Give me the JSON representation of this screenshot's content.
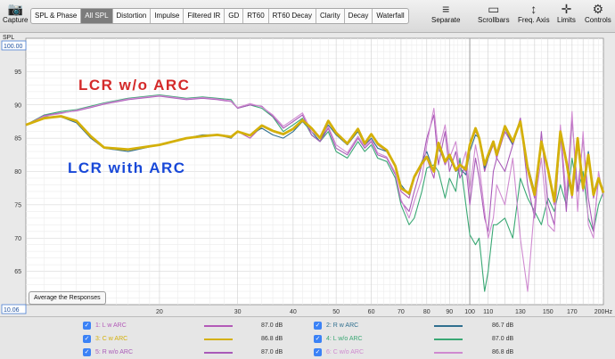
{
  "toolbar": {
    "capture": "Capture",
    "tabs": [
      "SPL & Phase",
      "All SPL",
      "Distortion",
      "Impulse",
      "Filtered IR",
      "GD",
      "RT60",
      "RT60 Decay",
      "Clarity",
      "Decay",
      "Waterfall"
    ],
    "active_tab": "All SPL",
    "tools": [
      "Separate",
      "Scrollbars",
      "Freq. Axis",
      "Limits",
      "Controls"
    ]
  },
  "plot": {
    "y_unit": "SPL",
    "y_top_box": "100.00",
    "y_bottom_box": "10.06",
    "annotation_top": "LCR w/o ARC",
    "annotation_bottom": "LCR with ARC",
    "annotation_top_color": "#d42a2a",
    "annotation_bottom_color": "#1848d8",
    "average_button": "Average the Responses"
  },
  "chart_data": {
    "type": "line",
    "xscale": "log",
    "xlim": [
      10,
      200
    ],
    "ylim": [
      60,
      100
    ],
    "y_ticks": [
      60,
      65,
      70,
      75,
      80,
      85,
      90,
      95
    ],
    "x_ticks": [
      {
        "v": 20,
        "label": "20"
      },
      {
        "v": 30,
        "label": "30"
      },
      {
        "v": 40,
        "label": "40"
      },
      {
        "v": 50,
        "label": "50"
      },
      {
        "v": 60,
        "label": "60"
      },
      {
        "v": 70,
        "label": "70"
      },
      {
        "v": 80,
        "label": "80"
      },
      {
        "v": 90,
        "label": "90"
      },
      {
        "v": 100,
        "label": "100"
      },
      {
        "v": 110,
        "label": "110"
      },
      {
        "v": 130,
        "label": "130"
      },
      {
        "v": 150,
        "label": "150"
      },
      {
        "v": 170,
        "label": "170"
      },
      {
        "v": 200,
        "label": "200Hz"
      }
    ],
    "marker_x": 100,
    "series": [
      {
        "name": "1: L w ARC",
        "color": "#b35ab8",
        "value": "87.0 dB",
        "width": 1.1,
        "x": [
          10,
          11,
          12,
          13,
          14,
          15,
          17,
          20,
          23,
          25,
          27,
          29,
          30,
          32,
          34,
          36,
          38,
          40,
          42,
          44,
          46,
          48,
          50,
          53,
          56,
          58,
          60,
          62,
          65,
          68,
          70,
          73,
          75,
          78,
          80,
          83,
          85,
          88,
          90,
          93,
          95,
          98,
          100,
          103,
          105,
          108,
          110,
          113,
          115,
          120,
          125,
          130,
          135,
          140,
          145,
          150,
          155,
          160,
          165,
          170,
          175,
          180,
          185,
          190,
          195,
          200
        ],
        "y": [
          87,
          88,
          88.3,
          87.5,
          85,
          83.5,
          83.2,
          84,
          85,
          85.3,
          85.5,
          85,
          86,
          85,
          86.8,
          86,
          85.5,
          86.5,
          87.5,
          86.5,
          85,
          87.5,
          86,
          84,
          86.5,
          84,
          85.5,
          84,
          83,
          81,
          77,
          76,
          79,
          81,
          82,
          79,
          84,
          81,
          82.5,
          80,
          81,
          80,
          84,
          86,
          85,
          80,
          82,
          84,
          82,
          86,
          84,
          88,
          80,
          76,
          84,
          80,
          75,
          86,
          81,
          76,
          84,
          77,
          82,
          76,
          79,
          77
        ]
      },
      {
        "name": "2: R w ARC",
        "color": "#2f6f8f",
        "value": "86.7 dB",
        "width": 1.1,
        "x": [
          10,
          11,
          12,
          13,
          14,
          15,
          17,
          20,
          23,
          25,
          27,
          29,
          30,
          32,
          34,
          36,
          38,
          40,
          42,
          44,
          46,
          48,
          50,
          53,
          56,
          58,
          60,
          62,
          65,
          68,
          70,
          73,
          75,
          78,
          80,
          83,
          85,
          88,
          90,
          93,
          95,
          98,
          100,
          103,
          105,
          108,
          110,
          113,
          115,
          120,
          125,
          130,
          135,
          140,
          145,
          150,
          155,
          160,
          165,
          170,
          175,
          180,
          185,
          190,
          195,
          200
        ],
        "y": [
          87,
          88.2,
          88.2,
          87.3,
          85,
          83.5,
          83,
          84,
          85,
          85.5,
          85.5,
          85,
          86,
          85.5,
          86.5,
          85.5,
          85,
          86,
          87.5,
          86,
          84.5,
          87,
          85.5,
          84,
          86,
          84,
          85,
          83.5,
          83,
          81,
          78,
          76.5,
          79,
          81.5,
          83,
          80,
          83.5,
          81.5,
          82,
          80,
          80.5,
          79.5,
          83,
          85.5,
          85,
          80.5,
          82,
          84.5,
          82.5,
          86.5,
          84,
          87.5,
          81,
          77,
          84.5,
          80,
          76,
          86,
          82,
          77,
          85,
          78,
          83,
          77,
          79,
          77
        ]
      },
      {
        "name": "3: C w ARC",
        "color": "#d4b00a",
        "value": "86.8 dB",
        "width": 2.8,
        "x": [
          10,
          11,
          12,
          13,
          14,
          15,
          17,
          20,
          23,
          25,
          27,
          29,
          30,
          32,
          34,
          36,
          38,
          40,
          42,
          44,
          46,
          48,
          50,
          53,
          56,
          58,
          60,
          62,
          65,
          68,
          70,
          73,
          75,
          78,
          80,
          83,
          85,
          88,
          90,
          93,
          95,
          98,
          100,
          103,
          105,
          108,
          110,
          113,
          115,
          120,
          125,
          130,
          135,
          140,
          145,
          150,
          155,
          160,
          165,
          170,
          175,
          180,
          185,
          190,
          195,
          200
        ],
        "y": [
          87,
          88,
          88.3,
          87.6,
          85.3,
          83.6,
          83.3,
          84,
          85,
          85.3,
          85.5,
          85.2,
          86,
          85.4,
          86.9,
          86.1,
          85.6,
          86.4,
          87.7,
          86.5,
          85,
          87.6,
          85.8,
          84.2,
          86.4,
          84.2,
          85.6,
          84.2,
          83.2,
          80.8,
          77.5,
          76.7,
          79.2,
          81.2,
          82.2,
          80,
          84.3,
          81.5,
          82.5,
          80.2,
          81,
          80.3,
          84,
          86.5,
          85,
          81,
          82.5,
          84.5,
          82.5,
          86.8,
          84.5,
          87.5,
          80.5,
          76.5,
          84.5,
          80.3,
          75.5,
          86,
          81.5,
          76.5,
          85,
          77.5,
          82.5,
          76.5,
          79,
          76.8
        ]
      },
      {
        "name": "4: L w/o ARC",
        "color": "#3aa874",
        "value": "87.0 dB",
        "width": 1.1,
        "x": [
          10,
          11,
          12,
          13,
          14,
          15,
          17,
          20,
          23,
          25,
          27,
          29,
          30,
          32,
          34,
          36,
          38,
          40,
          42,
          44,
          46,
          48,
          50,
          53,
          56,
          58,
          60,
          62,
          65,
          68,
          70,
          73,
          75,
          78,
          80,
          83,
          85,
          88,
          90,
          93,
          95,
          98,
          100,
          103,
          105,
          108,
          110,
          113,
          115,
          120,
          125,
          130,
          135,
          140,
          145,
          150,
          155,
          160,
          165,
          170,
          175,
          180,
          185,
          190,
          195,
          200
        ],
        "y": [
          87,
          88.5,
          89,
          89.3,
          89.8,
          90.3,
          91,
          91.5,
          91,
          91.2,
          91,
          90.8,
          89.5,
          90,
          89.5,
          88.2,
          86,
          87,
          88,
          85.5,
          84.5,
          86,
          83,
          82,
          84.5,
          83,
          84,
          82,
          81.5,
          79,
          75,
          72,
          73,
          77,
          80.5,
          81,
          80,
          76,
          79,
          77,
          82,
          75,
          70.5,
          69,
          70,
          62,
          65,
          72,
          72,
          73,
          70,
          79,
          76,
          74,
          72,
          76,
          74,
          78,
          75,
          82,
          77,
          80,
          73,
          71,
          75,
          77
        ]
      },
      {
        "name": "5: R w/o ARC",
        "color": "#a85ab8",
        "value": "87.0 dB",
        "width": 1.1,
        "x": [
          10,
          11,
          12,
          13,
          14,
          15,
          17,
          20,
          23,
          25,
          27,
          29,
          30,
          32,
          34,
          36,
          38,
          40,
          42,
          44,
          46,
          48,
          50,
          53,
          56,
          58,
          60,
          62,
          65,
          68,
          70,
          73,
          75,
          78,
          80,
          83,
          85,
          88,
          90,
          93,
          95,
          98,
          100,
          103,
          105,
          108,
          110,
          113,
          115,
          120,
          125,
          130,
          135,
          140,
          145,
          150,
          155,
          160,
          165,
          170,
          175,
          180,
          185,
          190,
          195,
          200
        ],
        "y": [
          87,
          88.4,
          88.8,
          89.1,
          89.6,
          90.1,
          90.8,
          91.3,
          90.8,
          91,
          90.8,
          90.5,
          89.5,
          90,
          89.8,
          88.3,
          86.5,
          87.5,
          88.5,
          85.5,
          84.5,
          86.5,
          83.5,
          82.5,
          85,
          83.5,
          84.5,
          82.5,
          82,
          79.5,
          75.5,
          74,
          77,
          81,
          85,
          88.5,
          81,
          86,
          80,
          83,
          79,
          81,
          75,
          82,
          79,
          73,
          71,
          80,
          82,
          80,
          84,
          88,
          78,
          73,
          86,
          75,
          72,
          86,
          74,
          88,
          77,
          85,
          76,
          71,
          79,
          77
        ]
      },
      {
        "name": "6: C w/o ARC",
        "color": "#cf8ad0",
        "value": "86.8 dB",
        "width": 1.1,
        "x": [
          10,
          11,
          12,
          13,
          14,
          15,
          17,
          20,
          23,
          25,
          27,
          29,
          30,
          32,
          34,
          36,
          38,
          40,
          42,
          44,
          46,
          48,
          50,
          53,
          56,
          58,
          60,
          62,
          65,
          68,
          70,
          73,
          75,
          78,
          80,
          83,
          85,
          88,
          90,
          93,
          95,
          98,
          100,
          103,
          105,
          108,
          110,
          113,
          115,
          120,
          125,
          130,
          135,
          140,
          145,
          150,
          155,
          160,
          165,
          170,
          175,
          180,
          185,
          190,
          195,
          200
        ],
        "y": [
          87,
          88.3,
          88.7,
          89.2,
          89.7,
          90.2,
          90.9,
          91.4,
          90.9,
          91.1,
          90.9,
          90.6,
          89.6,
          90.2,
          89.7,
          88.5,
          86.8,
          87.8,
          88.8,
          86,
          85,
          86.8,
          84,
          82.8,
          85.3,
          83.8,
          84.8,
          82.8,
          82.2,
          79.8,
          75.8,
          73,
          75.5,
          79,
          84,
          89.5,
          83,
          87,
          82,
          84.5,
          80,
          83,
          77,
          84,
          81,
          74,
          70,
          73,
          78,
          75,
          82,
          70,
          62,
          75,
          82,
          72,
          71,
          87,
          76,
          89,
          74,
          86,
          72,
          70,
          80,
          76
        ]
      }
    ]
  }
}
